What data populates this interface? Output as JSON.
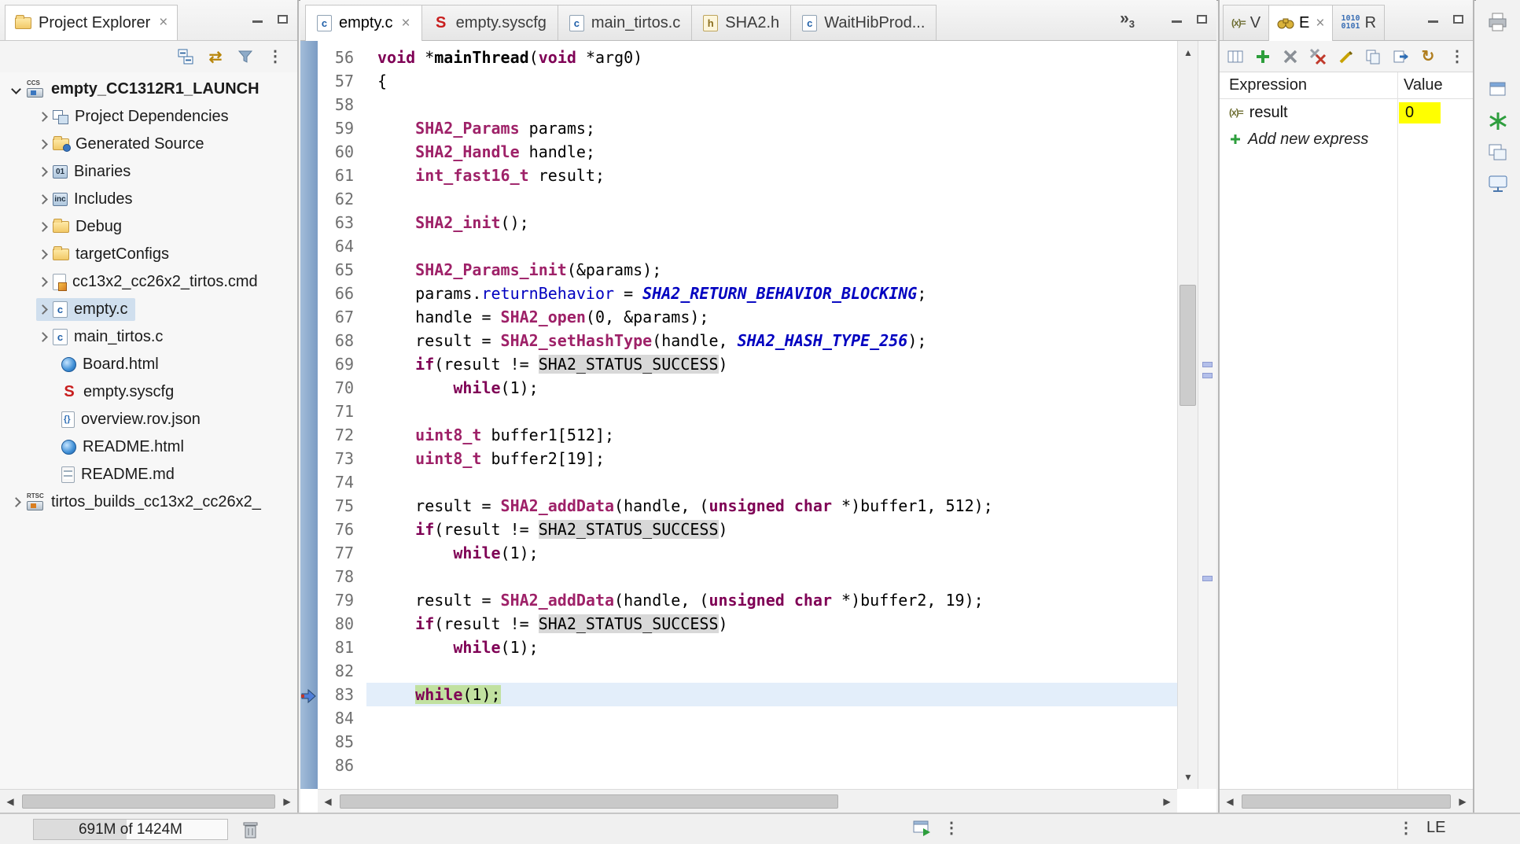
{
  "explorer": {
    "title": "Project Explorer",
    "root": "empty_CC1312R1_LAUNCH",
    "items": [
      {
        "label": "Project Dependencies"
      },
      {
        "label": "Generated Source"
      },
      {
        "label": "Binaries"
      },
      {
        "label": "Includes"
      },
      {
        "label": "Debug"
      },
      {
        "label": "targetConfigs"
      },
      {
        "label": "cc13x2_cc26x2_tirtos.cmd"
      },
      {
        "label": "empty.c"
      },
      {
        "label": "main_tirtos.c"
      },
      {
        "label": "Board.html"
      },
      {
        "label": "empty.syscfg"
      },
      {
        "label": "overview.rov.json"
      },
      {
        "label": "README.html"
      },
      {
        "label": "README.md"
      }
    ],
    "root2": "tirtos_builds_cc13x2_cc26x2_"
  },
  "editor": {
    "tabs": [
      {
        "label": "empty.c"
      },
      {
        "label": "empty.syscfg"
      },
      {
        "label": "main_tirtos.c"
      },
      {
        "label": "SHA2.h"
      },
      {
        "label": "WaitHibProd..."
      }
    ],
    "overflow_count": "3",
    "code": {
      "lines": [
        {
          "n": 56,
          "t": [
            [
              "void",
              "kw"
            ],
            [
              " *",
              "p"
            ],
            [
              "mainThread",
              "fn"
            ],
            [
              "(",
              "p"
            ],
            [
              "void",
              "kw"
            ],
            [
              " *arg0)",
              "p"
            ]
          ]
        },
        {
          "n": 57,
          "t": [
            [
              "{",
              "p"
            ]
          ]
        },
        {
          "n": 58,
          "t": []
        },
        {
          "n": 59,
          "t": [
            [
              "    ",
              "p"
            ],
            [
              "SHA2_Params",
              "ty"
            ],
            [
              " params;",
              "p"
            ]
          ]
        },
        {
          "n": 60,
          "t": [
            [
              "    ",
              "p"
            ],
            [
              "SHA2_Handle",
              "ty"
            ],
            [
              " handle;",
              "p"
            ]
          ]
        },
        {
          "n": 61,
          "t": [
            [
              "    ",
              "p"
            ],
            [
              "int_fast16_t",
              "ty"
            ],
            [
              " result;",
              "p"
            ]
          ]
        },
        {
          "n": 62,
          "t": []
        },
        {
          "n": 63,
          "t": [
            [
              "    ",
              "p"
            ],
            [
              "SHA2_init",
              "ty"
            ],
            [
              "();",
              "p"
            ]
          ]
        },
        {
          "n": 64,
          "t": []
        },
        {
          "n": 65,
          "t": [
            [
              "    ",
              "p"
            ],
            [
              "SHA2_Params_init",
              "ty"
            ],
            [
              "(&params);",
              "p"
            ]
          ]
        },
        {
          "n": 66,
          "t": [
            [
              "    params.",
              "p"
            ],
            [
              "returnBehavior",
              "fd"
            ],
            [
              " = ",
              "p"
            ],
            [
              "SHA2_RETURN_BEHAVIOR_BLOCKING",
              "en"
            ],
            [
              ";",
              "p"
            ]
          ]
        },
        {
          "n": 67,
          "t": [
            [
              "    handle = ",
              "p"
            ],
            [
              "SHA2_open",
              "ty"
            ],
            [
              "(0, &params);",
              "p"
            ]
          ]
        },
        {
          "n": 68,
          "t": [
            [
              "    result = ",
              "p"
            ],
            [
              "SHA2_setHashType",
              "ty"
            ],
            [
              "(handle, ",
              "p"
            ],
            [
              "SHA2_HASH_TYPE_256",
              "en"
            ],
            [
              ");",
              "p"
            ]
          ]
        },
        {
          "n": 69,
          "t": [
            [
              "    ",
              "p"
            ],
            [
              "if",
              "kw"
            ],
            [
              "(result != ",
              "p"
            ],
            [
              "SHA2_STATUS_SUCCESS",
              "oc"
            ],
            [
              ")",
              "p"
            ]
          ]
        },
        {
          "n": 70,
          "t": [
            [
              "        ",
              "p"
            ],
            [
              "while",
              "kw"
            ],
            [
              "(1);",
              "p"
            ]
          ]
        },
        {
          "n": 71,
          "t": []
        },
        {
          "n": 72,
          "t": [
            [
              "    ",
              "p"
            ],
            [
              "uint8_t",
              "ty"
            ],
            [
              " buffer1[512];",
              "p"
            ]
          ]
        },
        {
          "n": 73,
          "t": [
            [
              "    ",
              "p"
            ],
            [
              "uint8_t",
              "ty"
            ],
            [
              " buffer2[19];",
              "p"
            ]
          ]
        },
        {
          "n": 74,
          "t": []
        },
        {
          "n": 75,
          "t": [
            [
              "    result = ",
              "p"
            ],
            [
              "SHA2_addData",
              "ty"
            ],
            [
              "(handle, (",
              "p"
            ],
            [
              "unsigned",
              "kw"
            ],
            [
              " ",
              "p"
            ],
            [
              "char",
              "kw"
            ],
            [
              " *)buffer1, 512);",
              "p"
            ]
          ]
        },
        {
          "n": 76,
          "t": [
            [
              "    ",
              "p"
            ],
            [
              "if",
              "kw"
            ],
            [
              "(result != ",
              "p"
            ],
            [
              "SHA2_STATUS_SUCCESS",
              "oc"
            ],
            [
              ")",
              "p"
            ]
          ]
        },
        {
          "n": 77,
          "t": [
            [
              "        ",
              "p"
            ],
            [
              "while",
              "kw"
            ],
            [
              "(1);",
              "p"
            ]
          ]
        },
        {
          "n": 78,
          "t": []
        },
        {
          "n": 79,
          "t": [
            [
              "    result = ",
              "p"
            ],
            [
              "SHA2_addData",
              "ty"
            ],
            [
              "(handle, (",
              "p"
            ],
            [
              "unsigned",
              "kw"
            ],
            [
              " ",
              "p"
            ],
            [
              "char",
              "kw"
            ],
            [
              " *)buffer2, 19);",
              "p"
            ]
          ]
        },
        {
          "n": 80,
          "t": [
            [
              "    ",
              "p"
            ],
            [
              "if",
              "kw"
            ],
            [
              "(result != ",
              "p"
            ],
            [
              "SHA2_STATUS_SUCCESS",
              "oc"
            ],
            [
              ")",
              "p"
            ]
          ]
        },
        {
          "n": 81,
          "t": [
            [
              "        ",
              "p"
            ],
            [
              "while",
              "kw"
            ],
            [
              "(1);",
              "p"
            ]
          ]
        },
        {
          "n": 82,
          "t": []
        },
        {
          "n": 83,
          "c": true,
          "t": [
            [
              "    ",
              "p"
            ],
            [
              "while",
              "kw ex"
            ],
            [
              "(1);",
              "p ex"
            ]
          ]
        },
        {
          "n": 84,
          "t": []
        },
        {
          "n": 85,
          "t": []
        },
        {
          "n": 86,
          "t": []
        }
      ]
    }
  },
  "expressions": {
    "tabs": [
      {
        "label": "V"
      },
      {
        "label": "E"
      },
      {
        "label": "R"
      }
    ],
    "headers": {
      "expression": "Expression",
      "value": "Value"
    },
    "rows": [
      {
        "name": "result",
        "value": "0"
      }
    ],
    "add_label": "Add new express"
  },
  "status": {
    "heap": "691M of 1424M",
    "endianness": "LE"
  },
  "colors": {
    "value_changed_bg": "#ffff00",
    "exec_line_bg": "#c1e1a0",
    "current_line_bg": "#e3eefa",
    "keyword": "#7f0055",
    "enumerator": "#0000c0"
  }
}
